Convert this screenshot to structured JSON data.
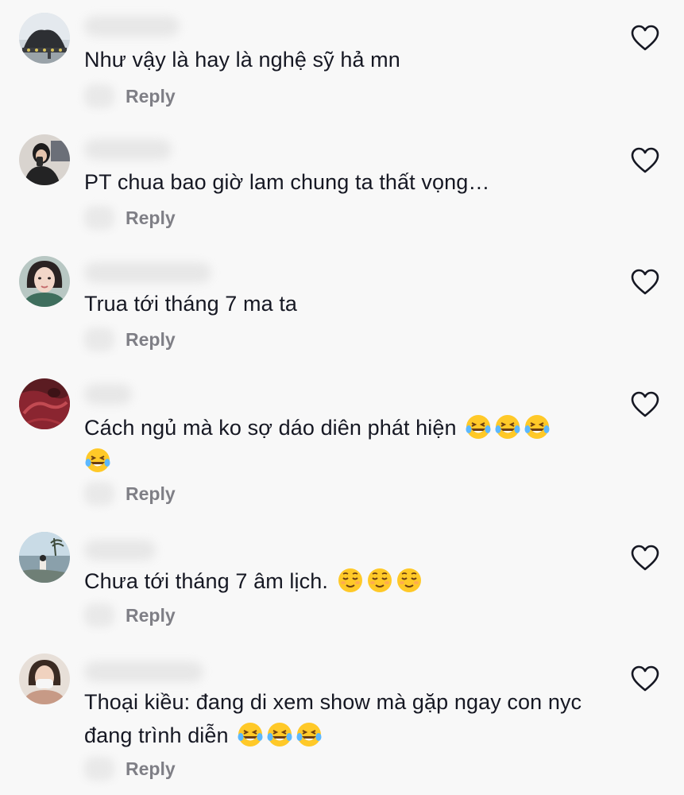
{
  "comments": [
    {
      "text": "Như vậy là hay là nghệ sỹ hả mn",
      "reply": "Reply",
      "emojis": []
    },
    {
      "text": "PT chua bao giờ lam chung ta thất vọng…",
      "reply": "Reply",
      "emojis": []
    },
    {
      "text": "Trua tới tháng 7 ma ta",
      "reply": "Reply",
      "emojis": []
    },
    {
      "text": "Cách ngủ mà ko sợ dáo diên phát hiện",
      "reply": "Reply",
      "emojis": [
        "laughing-tears",
        "laughing-tears",
        "laughing-tears",
        "laughing-tears"
      ]
    },
    {
      "text": "Chưa tới tháng 7 âm lịch.",
      "reply": "Reply",
      "emojis": [
        "relieved",
        "relieved",
        "relieved"
      ]
    },
    {
      "text": "Thoại kiều: đang di xem show mà gặp ngay con nyc đang trình diễn",
      "reply": "Reply",
      "emojis": [
        "laughing-tears",
        "laughing-tears",
        "laughing-tears"
      ]
    }
  ],
  "colors": {
    "background": "#f8f8f8",
    "text": "#161823",
    "reply": "#7f7f86",
    "heart_outline": "#161823"
  },
  "icons": {
    "like": "heart-outline-icon"
  }
}
